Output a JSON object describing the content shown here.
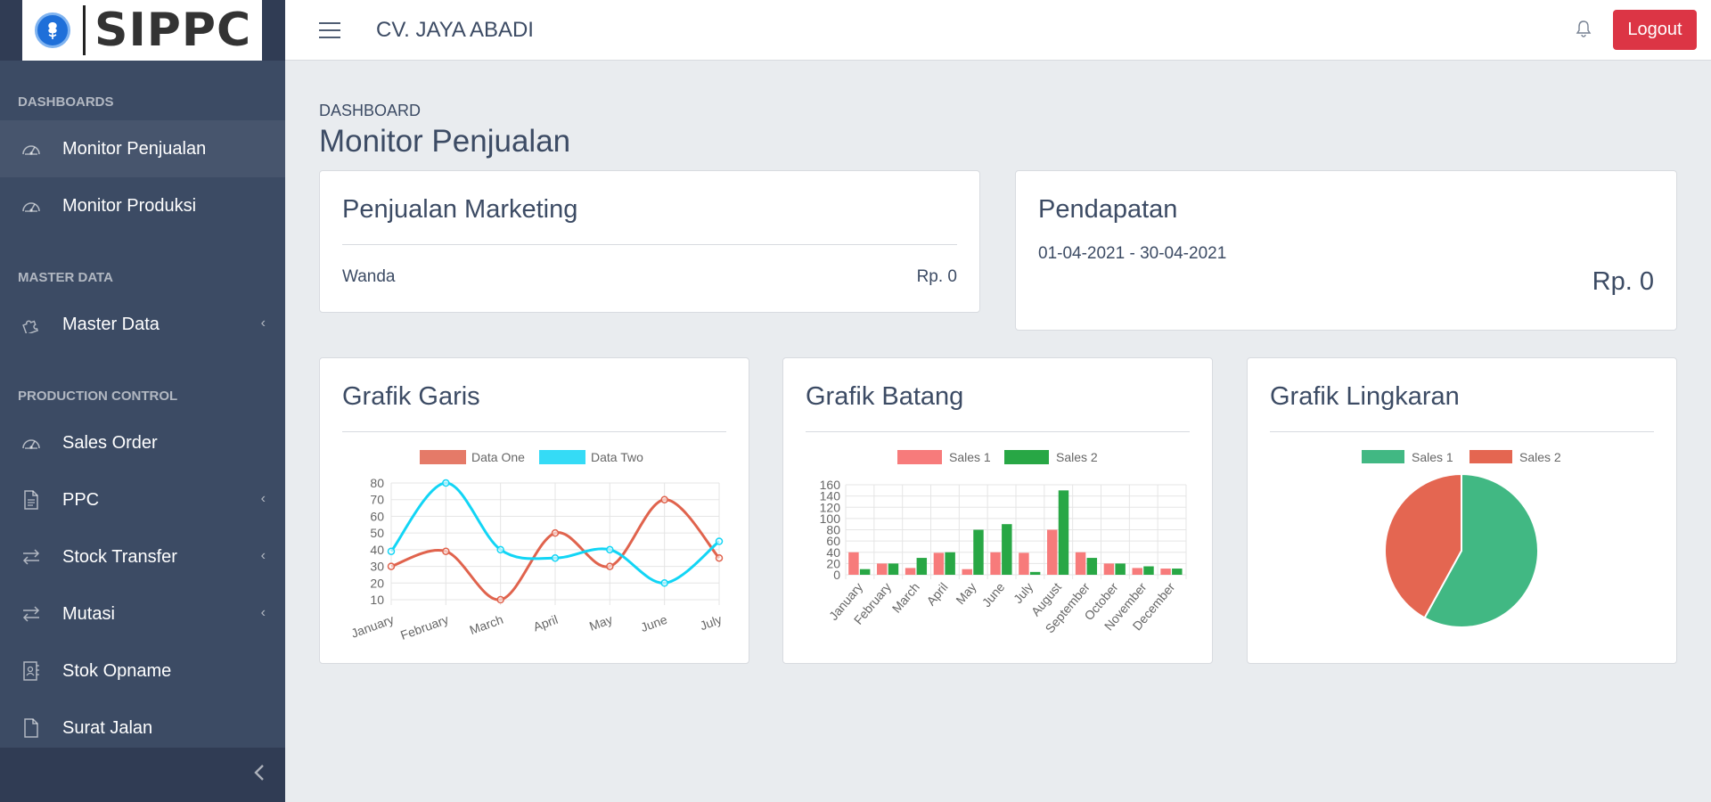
{
  "brand": {
    "name": "SIPPC"
  },
  "header": {
    "company": "CV. JAYA ABADI",
    "logout_label": "Logout"
  },
  "sidebar": {
    "sections": [
      {
        "title": "DASHBOARDS",
        "items": [
          {
            "label": "Monitor Penjualan",
            "icon": "speedometer-icon",
            "active": true
          },
          {
            "label": "Monitor Produksi",
            "icon": "speedometer-icon"
          }
        ]
      },
      {
        "title": "MASTER DATA",
        "items": [
          {
            "label": "Master Data",
            "icon": "puzzle-icon",
            "has_submenu": true
          }
        ]
      },
      {
        "title": "PRODUCTION CONTROL",
        "items": [
          {
            "label": "Sales Order",
            "icon": "speedometer-icon"
          },
          {
            "label": "PPC",
            "icon": "document-icon",
            "has_submenu": true
          },
          {
            "label": "Stock Transfer",
            "icon": "transfer-icon",
            "has_submenu": true
          },
          {
            "label": "Mutasi",
            "icon": "transfer-icon",
            "has_submenu": true
          },
          {
            "label": "Stok Opname",
            "icon": "inventory-icon"
          },
          {
            "label": "Surat Jalan",
            "icon": "file-icon"
          }
        ]
      }
    ]
  },
  "page": {
    "breadcrumb": "DASHBOARD",
    "title": "Monitor Penjualan"
  },
  "marketing": {
    "title": "Penjualan Marketing",
    "rows": [
      {
        "name": "Wanda",
        "value": "Rp. 0"
      }
    ]
  },
  "pendapatan": {
    "title": "Pendapatan",
    "period": "01-04-2021 - 30-04-2021",
    "total": "Rp. 0"
  },
  "charts": {
    "line_title": "Grafik Garis",
    "bar_title": "Grafik Batang",
    "pie_title": "Grafik Lingkaran"
  },
  "colors": {
    "sidebar": "#3c4b64",
    "logout": "#dc3545",
    "line1": "#e0634d",
    "line2": "#12d5f5",
    "bar1": "#f77b7b",
    "bar2": "#28a745",
    "pie1": "#41b883",
    "pie2": "#e46651"
  },
  "chart_data": [
    {
      "type": "line",
      "categories": [
        "January",
        "February",
        "March",
        "April",
        "May",
        "June",
        "July"
      ],
      "series": [
        {
          "name": "Data One",
          "values": [
            30,
            39,
            10,
            50,
            30,
            70,
            35
          ]
        },
        {
          "name": "Data Two",
          "values": [
            39,
            80,
            40,
            35,
            40,
            20,
            45
          ]
        }
      ],
      "ylim": [
        10,
        80
      ],
      "yticks": [
        10,
        20,
        30,
        40,
        50,
        60,
        70,
        80
      ],
      "legend": "top",
      "grid": true
    },
    {
      "type": "bar",
      "categories": [
        "January",
        "February",
        "March",
        "April",
        "May",
        "June",
        "July",
        "August",
        "September",
        "October",
        "November",
        "December"
      ],
      "series": [
        {
          "name": "Sales 1",
          "values": [
            40,
            20,
            12,
            39,
            10,
            40,
            39,
            80,
            40,
            20,
            12,
            11
          ]
        },
        {
          "name": "Sales 2",
          "values": [
            10,
            20,
            30,
            40,
            80,
            90,
            5,
            150,
            30,
            20,
            15,
            11
          ]
        }
      ],
      "ylim": [
        0,
        160
      ],
      "yticks": [
        0,
        20,
        40,
        60,
        80,
        100,
        120,
        140,
        160
      ],
      "legend": "top",
      "grid": true
    },
    {
      "type": "pie",
      "labels": [
        "Sales 1",
        "Sales 2"
      ],
      "values": [
        58,
        42
      ],
      "legend": "top"
    }
  ]
}
